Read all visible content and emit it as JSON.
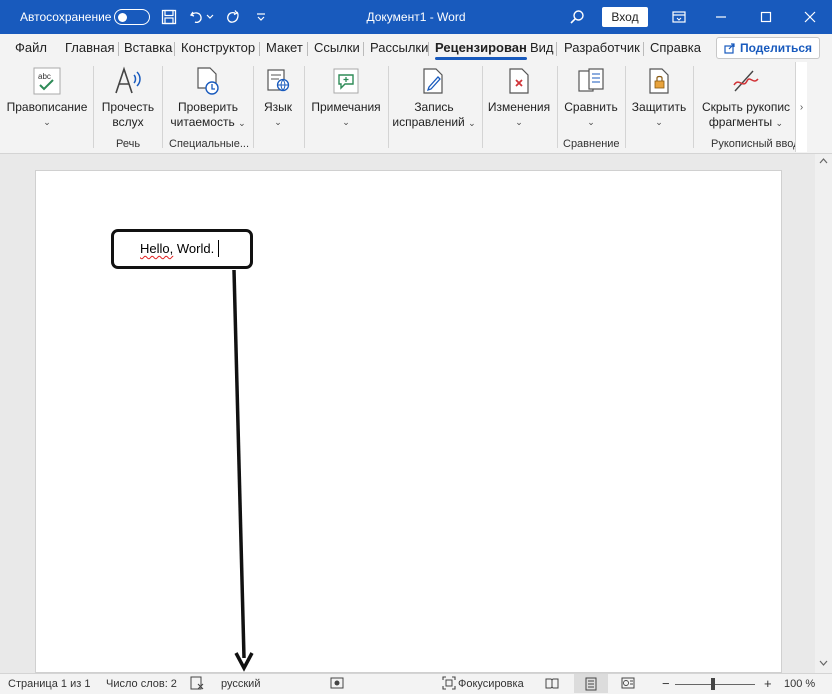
{
  "titlebar": {
    "autosave_label": "Автосохранение",
    "doc_title": "Документ1 - Word",
    "signin_label": "Вход",
    "bg_color": "#185abd"
  },
  "tabs": [
    {
      "label": "Файл"
    },
    {
      "label": "Главная"
    },
    {
      "label": "Вставка"
    },
    {
      "label": "Конструктор"
    },
    {
      "label": "Макет"
    },
    {
      "label": "Ссылки"
    },
    {
      "label": "Рассылки"
    },
    {
      "label": "Рецензирован",
      "active": true
    },
    {
      "label": "Вид"
    },
    {
      "label": "Разработчик"
    },
    {
      "label": "Справка"
    }
  ],
  "share_label": "Поделиться",
  "ribbon": {
    "spelling": {
      "line1": "Правописание",
      "icon": "abc-check-icon"
    },
    "read_aloud": {
      "line1": "Прочесть",
      "line2": "вслух",
      "icon": "read-aloud-icon"
    },
    "check_accessibility": {
      "line1": "Проверить",
      "line2": "читаемость",
      "icon": "accessibility-icon"
    },
    "language": {
      "line1": "Язык",
      "icon": "language-icon"
    },
    "comments": {
      "line1": "Примечания",
      "icon": "comment-icon"
    },
    "track_changes": {
      "line1": "Запись",
      "line2": "исправлений",
      "icon": "track-changes-icon"
    },
    "changes": {
      "line1": "Изменения",
      "icon": "changes-icon"
    },
    "compare": {
      "line1": "Сравнить",
      "icon": "compare-icon"
    },
    "protect": {
      "line1": "Защитить",
      "icon": "lock-icon"
    },
    "hide_ink": {
      "line1": "Скрыть рукопис",
      "line2": "фрагменты",
      "icon": "ink-icon"
    },
    "groups": {
      "speech": "Речь",
      "accessibility": "Специальные...",
      "compare": "Сравнение",
      "ink": "Рукописный ввод"
    }
  },
  "document": {
    "text_word1": "Hello,",
    "text_rest": " World."
  },
  "status": {
    "page": "Страница 1 из 1",
    "words": "Число слов: 2",
    "language": "русский",
    "focus": "Фокусировка",
    "zoom": "100 %",
    "zoom_level_percent": 100
  }
}
